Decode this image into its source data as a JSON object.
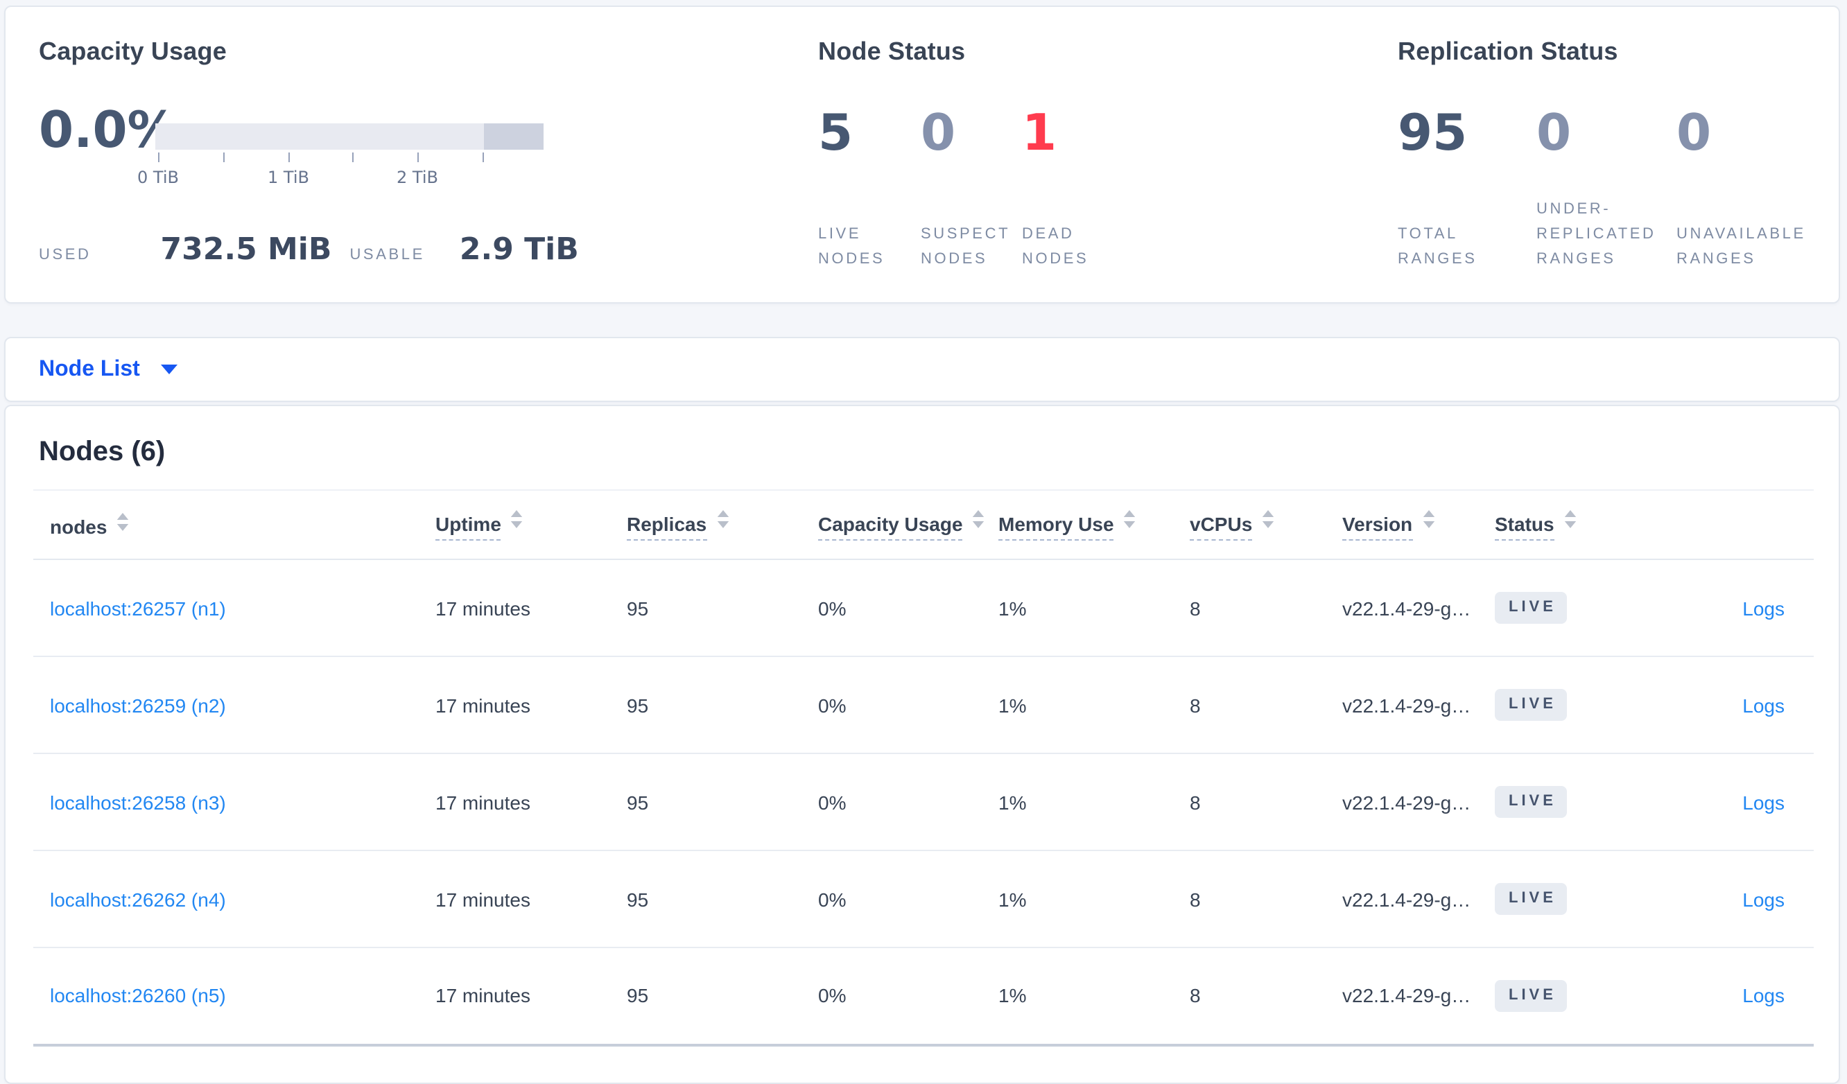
{
  "colors": {
    "accent_blue": "#1757f2",
    "link_blue": "#2287f2",
    "danger_red": "#ff3b4e",
    "stat_primary": "#475872",
    "stat_muted": "#8591ac",
    "badge_bg": "#e8ecf2"
  },
  "summary_panel": {
    "capacity": {
      "title": "Capacity Usage",
      "percent": "0.0%",
      "tick_labels": [
        "0 TiB",
        "1 TiB",
        "2 TiB"
      ],
      "used_label": "USED",
      "used_value": "732.5 MiB",
      "usable_label": "USABLE",
      "usable_value": "2.9 TiB"
    },
    "node_status": {
      "title": "Node Status",
      "stats": [
        {
          "value": "5",
          "label": "LIVE NODES",
          "tone": "primary"
        },
        {
          "value": "0",
          "label": "SUSPECT NODES",
          "tone": "muted"
        },
        {
          "value": "1",
          "label": "DEAD NODES",
          "tone": "danger"
        }
      ]
    },
    "replication_status": {
      "title": "Replication Status",
      "stats": [
        {
          "value": "95",
          "label": "TOTAL RANGES",
          "tone": "primary"
        },
        {
          "value": "0",
          "label": "UNDER-REPLICATED RANGES",
          "tone": "muted"
        },
        {
          "value": "0",
          "label": "UNAVAILABLE RANGES",
          "tone": "muted"
        }
      ]
    }
  },
  "view_selector": {
    "label": "Node List"
  },
  "nodes_table": {
    "title": "Nodes (6)",
    "columns": [
      {
        "label": "nodes",
        "sortable": true,
        "underline": false
      },
      {
        "label": "Uptime",
        "sortable": true,
        "underline": true
      },
      {
        "label": "Replicas",
        "sortable": true,
        "underline": true
      },
      {
        "label": "Capacity Usage",
        "sortable": true,
        "underline": true
      },
      {
        "label": "Memory Use",
        "sortable": true,
        "underline": true
      },
      {
        "label": "vCPUs",
        "sortable": true,
        "underline": true
      },
      {
        "label": "Version",
        "sortable": true,
        "underline": true
      },
      {
        "label": "Status",
        "sortable": true,
        "underline": true
      },
      {
        "label": "",
        "sortable": false,
        "underline": false
      }
    ],
    "rows": [
      {
        "node": "localhost:26257 (n1)",
        "uptime": "17 minutes",
        "replicas": "95",
        "capacity_usage": "0%",
        "memory_use": "1%",
        "vcpus": "8",
        "version": "v22.1.4-29-g…",
        "status": "LIVE",
        "logs": "Logs"
      },
      {
        "node": "localhost:26259 (n2)",
        "uptime": "17 minutes",
        "replicas": "95",
        "capacity_usage": "0%",
        "memory_use": "1%",
        "vcpus": "8",
        "version": "v22.1.4-29-g…",
        "status": "LIVE",
        "logs": "Logs"
      },
      {
        "node": "localhost:26258 (n3)",
        "uptime": "17 minutes",
        "replicas": "95",
        "capacity_usage": "0%",
        "memory_use": "1%",
        "vcpus": "8",
        "version": "v22.1.4-29-g…",
        "status": "LIVE",
        "logs": "Logs"
      },
      {
        "node": "localhost:26262 (n4)",
        "uptime": "17 minutes",
        "replicas": "95",
        "capacity_usage": "0%",
        "memory_use": "1%",
        "vcpus": "8",
        "version": "v22.1.4-29-g…",
        "status": "LIVE",
        "logs": "Logs"
      },
      {
        "node": "localhost:26260 (n5)",
        "uptime": "17 minutes",
        "replicas": "95",
        "capacity_usage": "0%",
        "memory_use": "1%",
        "vcpus": "8",
        "version": "v22.1.4-29-g…",
        "status": "LIVE",
        "logs": "Logs"
      }
    ]
  }
}
